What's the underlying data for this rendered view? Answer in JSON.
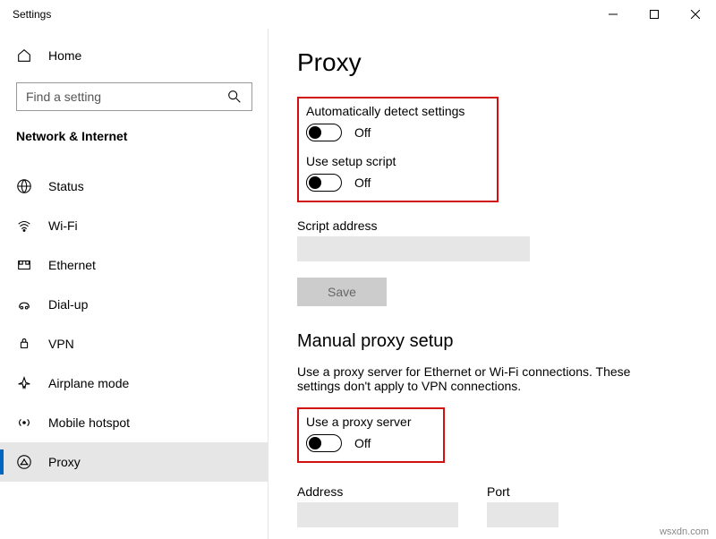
{
  "window": {
    "title": "Settings"
  },
  "sidebar": {
    "home": "Home",
    "searchPlaceholder": "Find a setting",
    "category": "Network & Internet",
    "items": [
      {
        "label": "Status"
      },
      {
        "label": "Wi-Fi"
      },
      {
        "label": "Ethernet"
      },
      {
        "label": "Dial-up"
      },
      {
        "label": "VPN"
      },
      {
        "label": "Airplane mode"
      },
      {
        "label": "Mobile hotspot"
      },
      {
        "label": "Proxy"
      }
    ]
  },
  "main": {
    "title": "Proxy",
    "auto": {
      "detectLabel": "Automatically detect settings",
      "detectState": "Off",
      "scriptLabel": "Use setup script",
      "scriptState": "Off",
      "scriptAddressLabel": "Script address",
      "saveLabel": "Save"
    },
    "manual": {
      "sectionTitle": "Manual proxy setup",
      "description": "Use a proxy server for Ethernet or Wi-Fi connections. These settings don't apply to VPN connections.",
      "useProxyLabel": "Use a proxy server",
      "useProxyState": "Off",
      "addressLabel": "Address",
      "portLabel": "Port"
    }
  },
  "watermark": "wsxdn.com"
}
